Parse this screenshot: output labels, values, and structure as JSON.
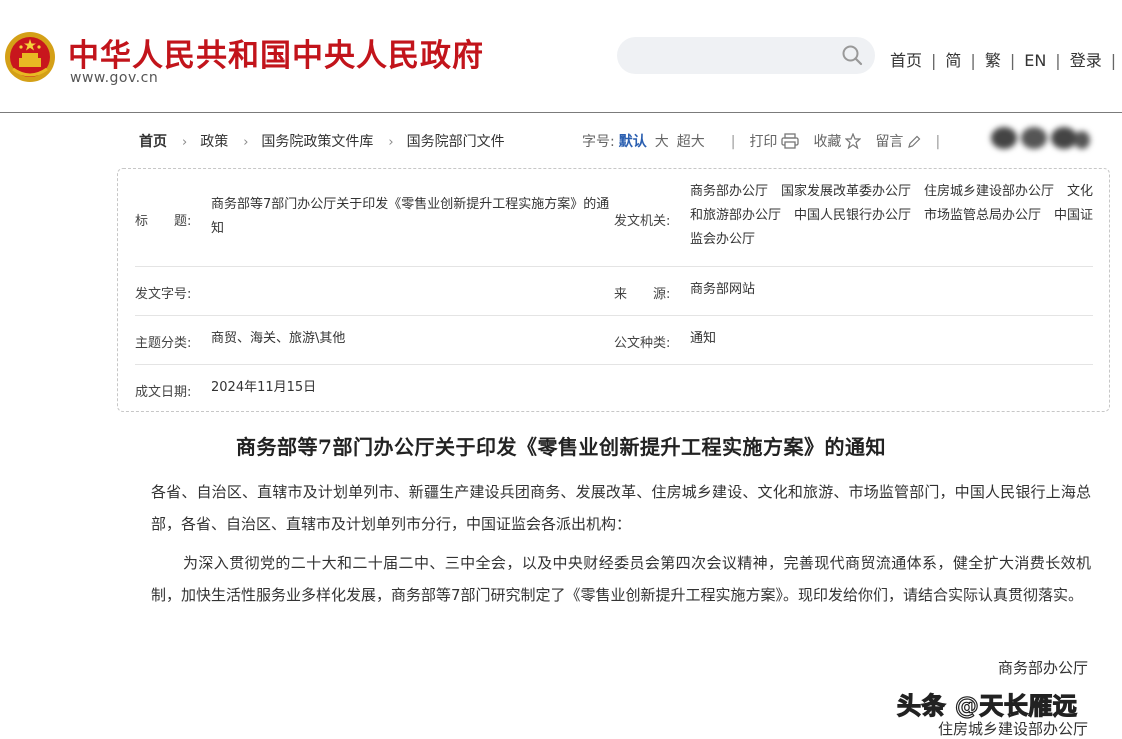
{
  "header": {
    "site_title": "中华人民共和国中央人民政府",
    "site_domain": "www.gov.cn",
    "search_placeholder": "",
    "links": [
      "首页",
      "简",
      "繁",
      "EN",
      "登录"
    ],
    "separator": "|"
  },
  "breadcrumb": {
    "items": [
      "首页",
      "政策",
      "国务院政策文件库",
      "国务院部门文件"
    ],
    "arrow": "›"
  },
  "tools": {
    "font_size_label": "字号:",
    "font_sizes": [
      "默认",
      "大",
      "超大"
    ],
    "print_label": "打印",
    "favorite_label": "收藏",
    "comment_label": "留言",
    "separator": "|"
  },
  "info": {
    "title_label": "标　　题:",
    "title_value": "商务部等7部门办公厅关于印发《零售业创新提升工程实施方案》的通知",
    "issuer_label": "发文机关:",
    "issuer_value": "商务部办公厅　国家发展改革委办公厅　住房城乡建设部办公厅　文化和旅游部办公厅　中国人民银行办公厅　市场监管总局办公厅　中国证监会办公厅",
    "doc_no_label": "发文字号:",
    "doc_no_value": "",
    "source_label": "来　　源:",
    "source_value": "商务部网站",
    "topic_label": "主题分类:",
    "topic_value": "商贸、海关、旅游\\其他",
    "type_label": "公文种类:",
    "type_value": "通知",
    "date_label": "成文日期:",
    "date_value": "2024年11月15日"
  },
  "article": {
    "title": "商务部等7部门办公厅关于印发《零售业创新提升工程实施方案》的通知",
    "paragraphs": [
      "各省、自治区、直辖市及计划单列市、新疆生产建设兵团商务、发展改革、住房城乡建设、文化和旅游、市场监管部门，中国人民银行上海总部，各省、自治区、直辖市及计划单列市分行，中国证监会各派出机构：",
      "为深入贯彻党的二十大和二十届二中、三中全会，以及中央财经委员会第四次会议精神，完善现代商贸流通体系，健全扩大消费长效机制，加快生活性服务业多样化发展，商务部等7部门研究制定了《零售业创新提升工程实施方案》。现印发给你们，请结合实际认真贯彻落实。"
    ],
    "signatures": [
      "商务部办公厅",
      "住房城乡建设部办公厅"
    ]
  },
  "watermark": "头条 @天长雁远",
  "colors": {
    "brand_red": "#c2141b",
    "link_blue": "#2b5fb0",
    "search_bg": "#eff1f4"
  }
}
